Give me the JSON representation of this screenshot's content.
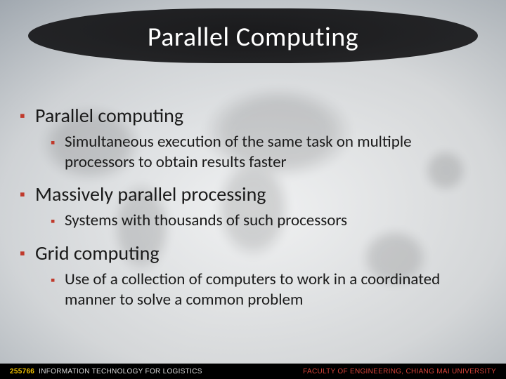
{
  "title": "Parallel Computing",
  "bullets": {
    "b1": "Parallel computing",
    "b1s": "Simultaneous execution of the same task on multiple processors to obtain results faster",
    "b2": "Massively parallel processing",
    "b2s": "Systems with thousands of such processors",
    "b3": "Grid computing",
    "b3s": "Use of a collection of computers to work in a coordinated manner to solve a common problem"
  },
  "footer": {
    "course_code": "255766",
    "course_name": "INFORMATION TECHNOLOGY FOR LOGISTICS",
    "faculty": "FACULTY OF ENGINEERING, CHIANG MAI UNIVERSITY"
  }
}
